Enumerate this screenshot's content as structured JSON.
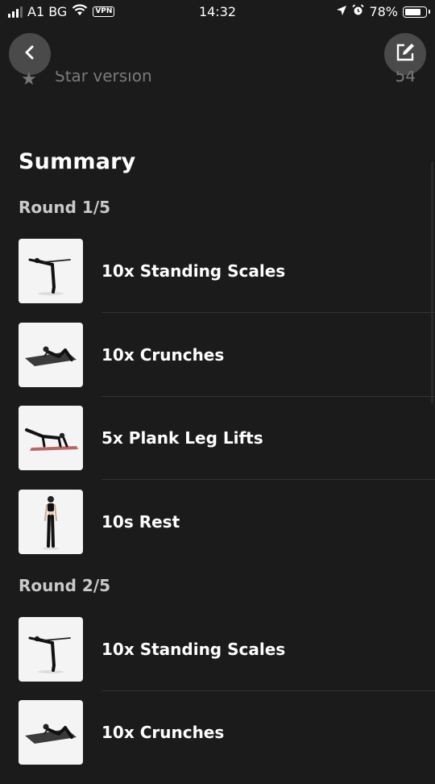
{
  "status_bar": {
    "carrier": "A1 BG",
    "vpn": "VPN",
    "time": "14:32",
    "battery": "78%",
    "battery_level": 0.78,
    "signal_bars": 3
  },
  "nav": {
    "back_icon": "chevron-left-icon",
    "edit_icon": "edit-icon"
  },
  "peek_item": {
    "label": "Star version",
    "value": "54"
  },
  "summary": {
    "title": "Summary",
    "rounds": [
      {
        "title": "Round 1/5",
        "exercises": [
          {
            "label": "10x Standing Scales",
            "image": "standing-scales-figure"
          },
          {
            "label": "10x Crunches",
            "image": "crunches-figure"
          },
          {
            "label": "5x Plank Leg Lifts",
            "image": "plank-leg-lifts-figure"
          },
          {
            "label": "10s Rest",
            "image": "rest-figure"
          }
        ]
      },
      {
        "title": "Round 2/5",
        "exercises": [
          {
            "label": "10x Standing Scales",
            "image": "standing-scales-figure"
          },
          {
            "label": "10x Crunches",
            "image": "crunches-figure"
          }
        ]
      }
    ]
  }
}
